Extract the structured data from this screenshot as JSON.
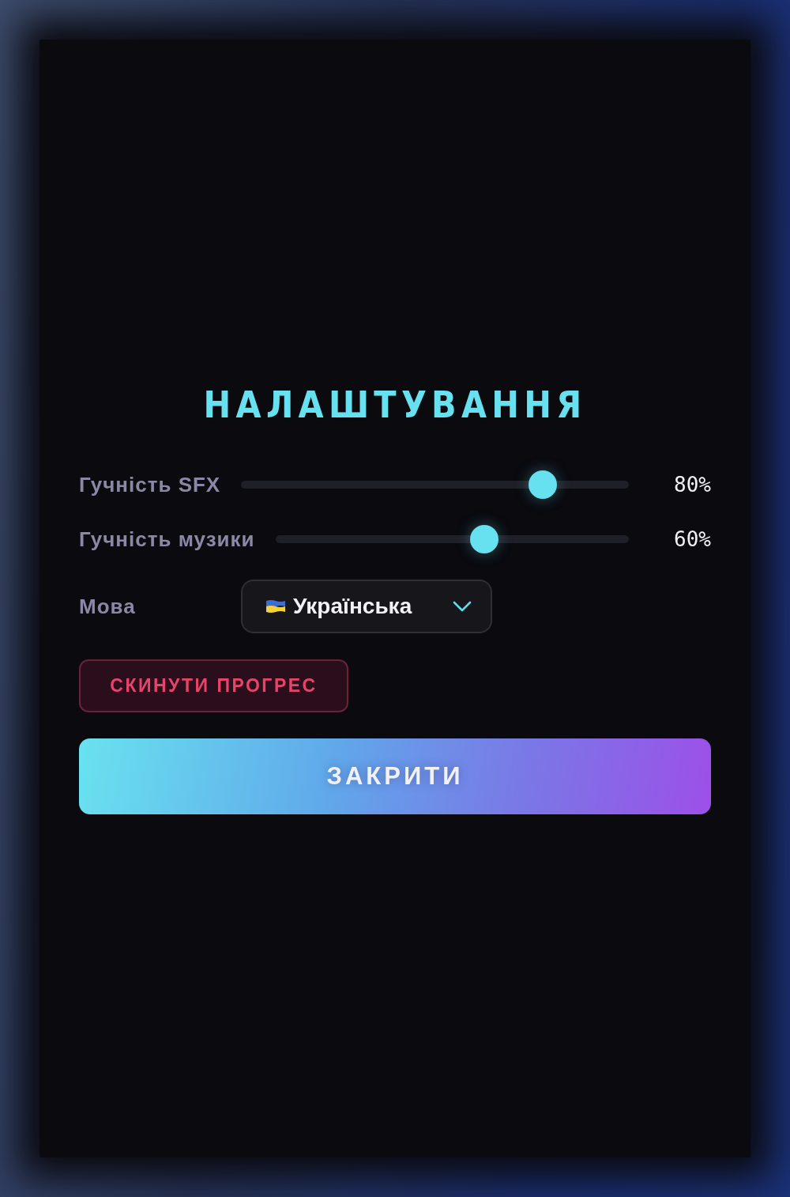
{
  "title": "НАЛАШТУВАННЯ",
  "sliders": [
    {
      "label": "Гучність SFX",
      "level": 0.8,
      "reading": "80%"
    },
    {
      "label": "Гучність музики",
      "level": 0.6,
      "reading": "60%"
    }
  ],
  "language": {
    "label": "Мова",
    "value": "Українська"
  },
  "buttons": [
    {
      "kind": "danger",
      "label": "СКИНУТИ ПРОГРЕС"
    },
    {
      "kind": "primary",
      "label": "ЗАКРИТИ"
    }
  ]
}
